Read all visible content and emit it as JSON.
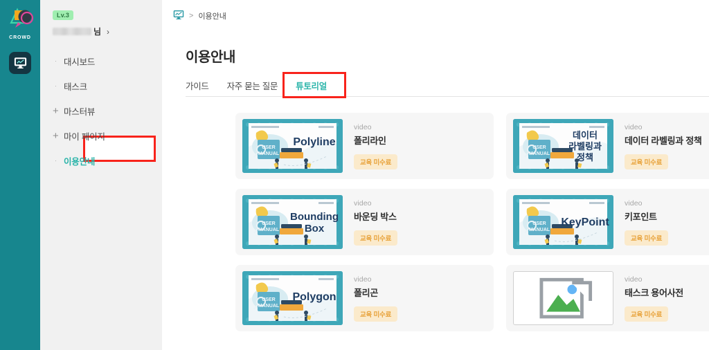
{
  "rail": {
    "brand_word": "CROWD",
    "brand_icon": "crowd-logo-icon",
    "buttons": [
      {
        "icon": "monitor-chart-icon",
        "name": "workspace-icon-button"
      }
    ]
  },
  "sidebar": {
    "level_badge": "Lv.3",
    "user_name": "",
    "user_suffix": "님",
    "user_chevron": "›",
    "items": [
      {
        "label": "대시보드",
        "mark": "·",
        "mark_type": "dot",
        "active": false
      },
      {
        "label": "태스크",
        "mark": "·",
        "mark_type": "dot",
        "active": false
      },
      {
        "label": "마스터뷰",
        "mark": "+",
        "mark_type": "plus",
        "active": false
      },
      {
        "label": "마이 페이지",
        "mark": "+",
        "mark_type": "plus",
        "active": false
      },
      {
        "label": "이용안내",
        "mark": "·",
        "mark_type": "dot",
        "active": true
      }
    ]
  },
  "breadcrumb": {
    "home_icon": "monitor-chart-icon",
    "separator": ">",
    "current": "이용안내"
  },
  "main": {
    "title": "이용안내",
    "tabs": [
      {
        "label": "가이드",
        "active": false
      },
      {
        "label": "자주 묻는 질문",
        "active": false
      },
      {
        "label": "튜토리얼",
        "active": true
      }
    ]
  },
  "cards": [
    {
      "kind": "video",
      "title": "폴리라인",
      "badge": "교육 미수료",
      "thumb_text": "Polyline",
      "thumb_state": "image",
      "thumb_label": "USER MANUAL"
    },
    {
      "kind": "video",
      "title": "데이터 라벨링과 정책",
      "badge": "교육 미수료",
      "thumb_text": "데이터\n라벨링과\n정책",
      "thumb_state": "image",
      "thumb_label": "USER MANUAL"
    },
    {
      "kind": "video",
      "title": "바운딩 박스",
      "badge": "교육 미수료",
      "thumb_text": "Bounding\nBox",
      "thumb_state": "image",
      "thumb_label": "USER MANUAL"
    },
    {
      "kind": "video",
      "title": "키포인트",
      "badge": "교육 미수료",
      "thumb_text": "KeyPoint",
      "thumb_state": "image",
      "thumb_label": "USER MANUAL"
    },
    {
      "kind": "video",
      "title": "폴리곤",
      "badge": "교육 미수료",
      "thumb_text": "Polygon",
      "thumb_state": "image",
      "thumb_label": "USER MANUAL"
    },
    {
      "kind": "video",
      "title": "태스크 용어사전",
      "badge": "교육 미수료",
      "thumb_text": "",
      "thumb_state": "broken",
      "thumb_label": ""
    }
  ],
  "colors": {
    "rail_teal": "#17868e",
    "accent_teal": "#2fb6ab",
    "highlight_red": "#f8231b",
    "badge_bg": "#fbeacb",
    "badge_text": "#e8a33c",
    "level_badge_bg": "#a0eeb0",
    "card_bg": "#f6f6f6",
    "menu_bg": "#f1f1f1"
  }
}
